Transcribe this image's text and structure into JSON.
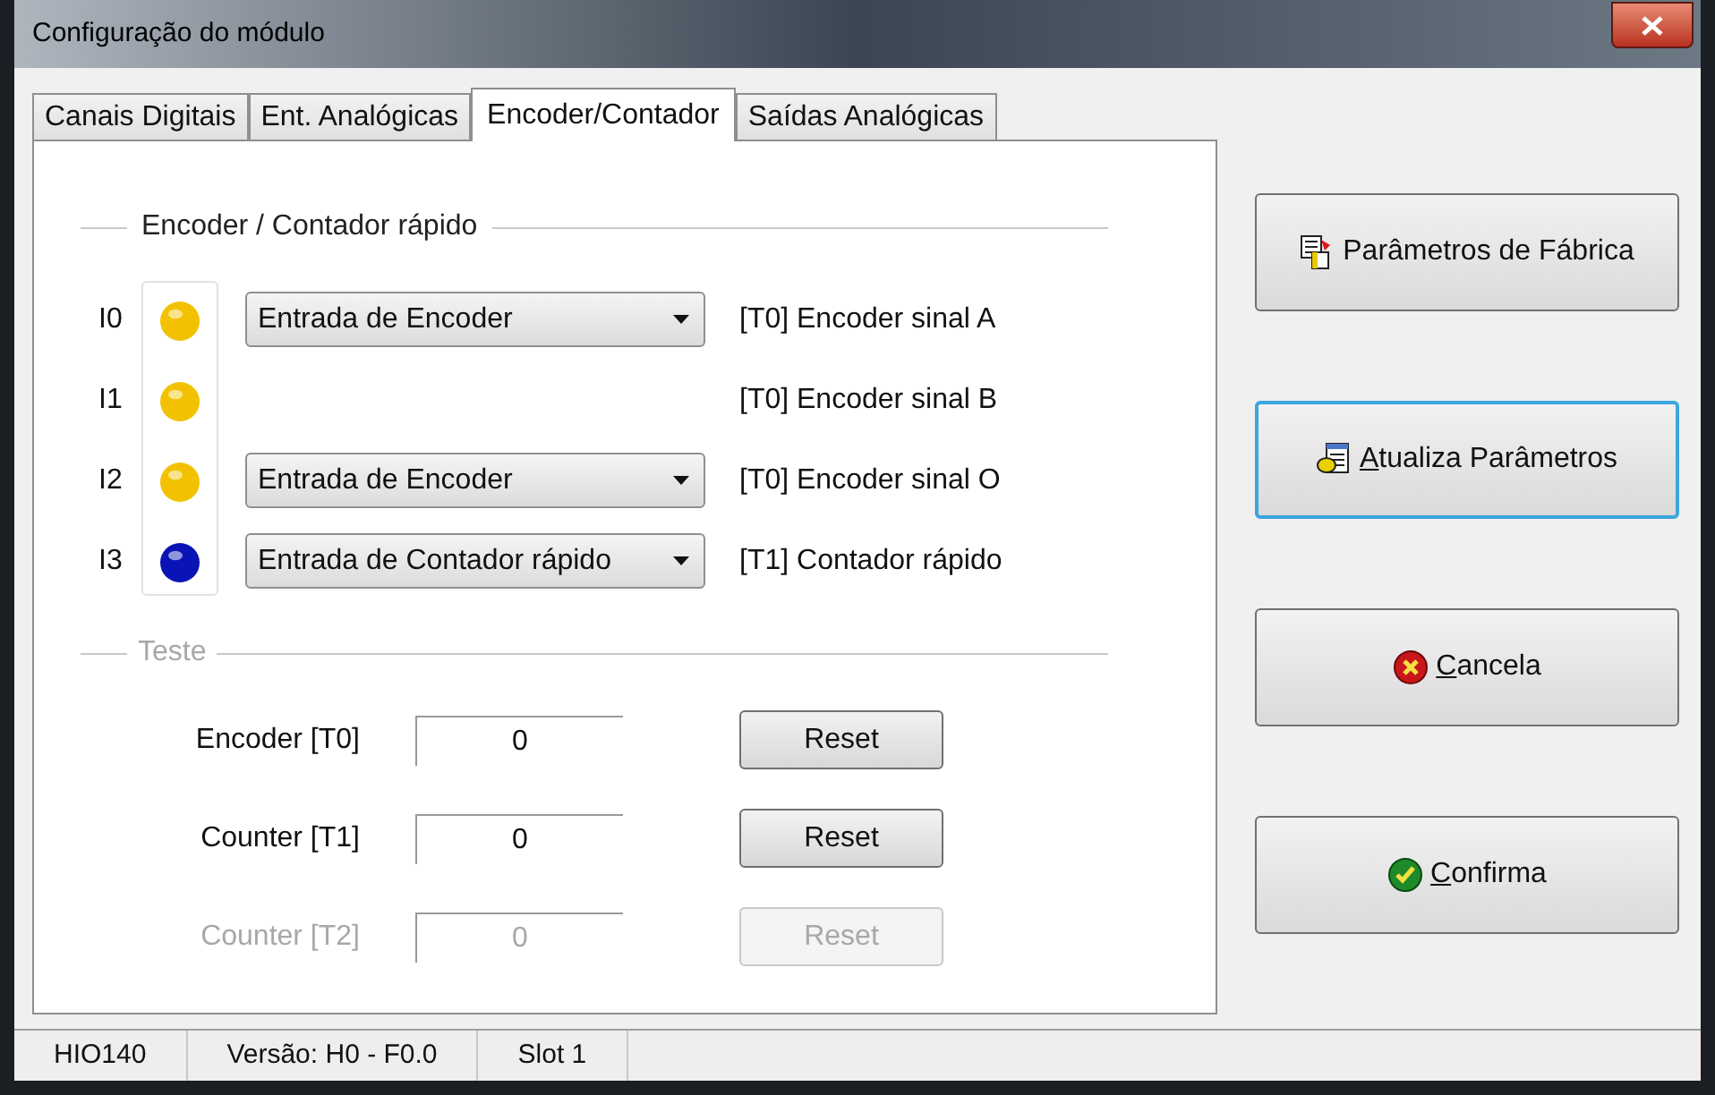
{
  "window": {
    "title": "Configuração do módulo"
  },
  "tabs": [
    {
      "label": "Canais Digitais",
      "selected": false
    },
    {
      "label": "Ent. Analógicas",
      "selected": false
    },
    {
      "label": "Encoder/Contador",
      "selected": true
    },
    {
      "label": "Saídas Analógicas",
      "selected": false
    }
  ],
  "encoder_group": {
    "title": "Encoder / Contador rápido",
    "channels": [
      {
        "input": "I0",
        "color": "#f2c200",
        "mode": "Entrada de Encoder",
        "function": "[T0] Encoder sinal A"
      },
      {
        "input": "I1",
        "color": "#f2c200",
        "function": "[T0] Encoder sinal B"
      },
      {
        "input": "I2",
        "color": "#f2c200",
        "mode": "Entrada de Encoder",
        "function": "[T0] Encoder sinal O"
      },
      {
        "input": "I3",
        "color": "#0a14b4",
        "mode": "Entrada de Contador rápido",
        "function": "[T1] Contador rápido"
      }
    ]
  },
  "test_group": {
    "title": "Teste",
    "rows": [
      {
        "label": "Encoder [T0]",
        "value": "0",
        "button": "Reset",
        "disabled": false
      },
      {
        "label": "Counter [T1]",
        "value": "0",
        "button": "Reset",
        "disabled": false
      },
      {
        "label": "Counter [T2]",
        "value": "0",
        "button": "Reset",
        "disabled": true
      }
    ]
  },
  "actions": [
    {
      "kind": "factory",
      "label": "Parâmetros de Fábrica",
      "underline_first": false,
      "focused": false
    },
    {
      "kind": "update",
      "label": "Atualiza Parâmetros",
      "underline_first": true,
      "focused": true
    },
    {
      "kind": "cancel",
      "label": "Cancela",
      "underline_first": true,
      "focused": false
    },
    {
      "kind": "confirm",
      "label": "Confirma",
      "underline_first": true,
      "focused": false
    }
  ],
  "status_bar": [
    "HIO140",
    "Versão: H0 - F0.0",
    "Slot 1"
  ]
}
